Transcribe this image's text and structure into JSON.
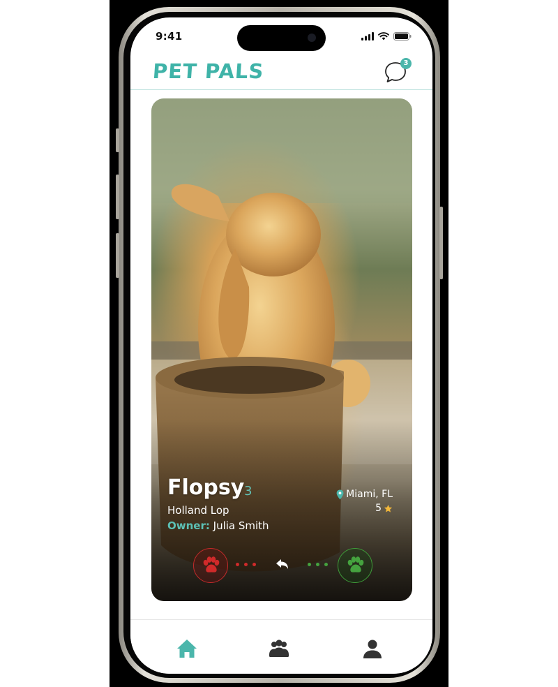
{
  "status_bar": {
    "time": "9:41"
  },
  "header": {
    "logo": "PET PALS",
    "unread_count": "3"
  },
  "pet": {
    "name": "Flopsy",
    "age": "3",
    "breed": "Holland Lop",
    "owner_label": "Owner:",
    "owner_name": "Julia Smith",
    "location": "Miami, FL",
    "rating": "5"
  },
  "colors": {
    "brand": "#3fb3a8",
    "dislike": "#c22a2a",
    "like": "#3e9b39",
    "star": "#f2b73a"
  },
  "icons": {
    "chat": "chat-bubble-icon",
    "location": "map-pin-icon",
    "rating": "star-icon",
    "dislike": "paw-icon",
    "undo": "undo-arrow-icon",
    "like": "paw-icon",
    "tab_home": "home-icon",
    "tab_friends": "group-icon",
    "tab_profile": "user-icon"
  },
  "tabs": {
    "active": "home"
  }
}
